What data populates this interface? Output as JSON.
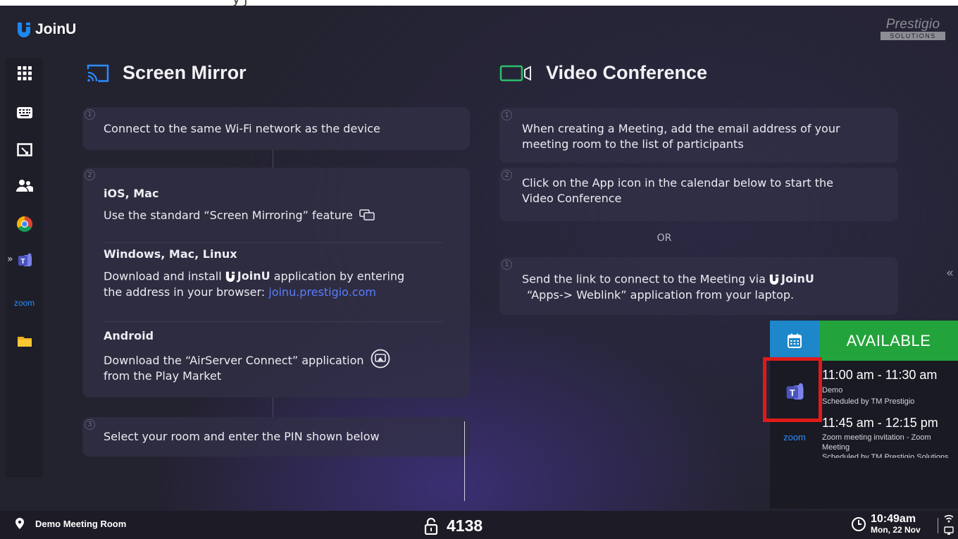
{
  "top_partial_text": "y j",
  "app": {
    "name": "JoinU",
    "vendor": "Prestigio",
    "vendor_sub": "SOLUTIONS"
  },
  "sidebar": {
    "items": [
      {
        "name": "apps-grid-icon"
      },
      {
        "name": "keyboard-icon"
      },
      {
        "name": "screen-annotate-icon"
      },
      {
        "name": "users-icon"
      },
      {
        "name": "chrome-icon"
      },
      {
        "name": "teams-icon"
      },
      {
        "name": "zoom-icon",
        "label": "zoom"
      },
      {
        "name": "folder-icon"
      }
    ],
    "expand_icon": "»"
  },
  "screen_mirror": {
    "title": "Screen Mirror",
    "step1": {
      "num": "1",
      "text": "Connect to the same Wi-Fi network as the device"
    },
    "step2": {
      "num": "2",
      "ios_title": "iOS, Mac",
      "ios_text": "Use the standard “Screen Mirroring” feature",
      "win_title": "Windows, Mac, Linux",
      "win_text_a": "Download and install",
      "win_app": "JoinU",
      "win_text_b": "application by entering",
      "win_text_c": "the address in your browser:",
      "win_link": "joinu.prestigio.com",
      "android_title": "Android",
      "android_text_a": "Download the “AirServer Connect” application",
      "android_text_b": "from the Play Market"
    },
    "step3": {
      "num": "3",
      "text": "Select your room and enter the PIN shown below"
    }
  },
  "video_conference": {
    "title": "Video Conference",
    "step1": {
      "num": "1",
      "text_a": "When creating a Meeting, add the email address of your",
      "text_b": "meeting room to the list of participants"
    },
    "step2": {
      "num": "2",
      "text_a": "Click on the App icon in the calendar below to start the",
      "text_b": "Video Conference"
    },
    "or": "OR",
    "alt": {
      "num": "1",
      "text_a": "Send the link to connect to the Meeting via",
      "app": "JoinU",
      "text_b": "“Apps-> Weblink” application from your laptop."
    }
  },
  "collapse_icon": "«",
  "calendar": {
    "status": "AVAILABLE",
    "status_color": "#23a33b",
    "meetings": [
      {
        "app": "teams",
        "time": "11:00 am - 11:30 am",
        "title": "Demo",
        "organizer": "Scheduled by TM Prestigio"
      },
      {
        "app": "zoom",
        "app_label": "zoom",
        "time": "11:45 am - 12:15 pm",
        "title_a": "Zoom meeting invitation - Zoom",
        "title_b": "Meeting",
        "organizer": "Scheduled by TM Prestigio Solutions"
      }
    ]
  },
  "footer": {
    "room": "Demo Meeting Room",
    "pin": "4138",
    "time": "10:49am",
    "date": "Mon, 22 Nov"
  }
}
